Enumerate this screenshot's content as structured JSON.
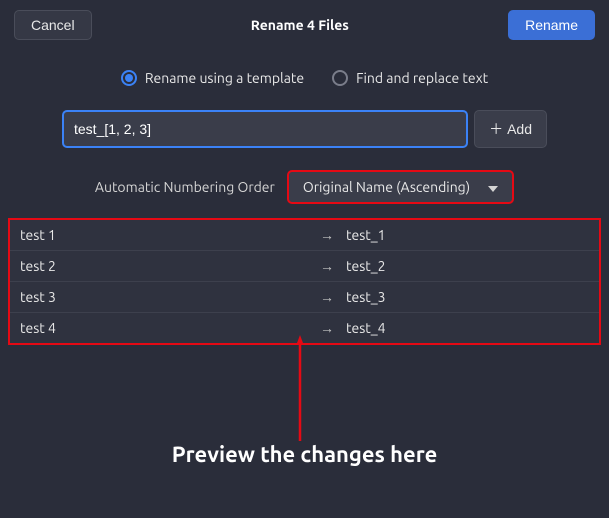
{
  "header": {
    "cancel": "Cancel",
    "title": "Rename 4 Files",
    "rename": "Rename"
  },
  "mode": {
    "template": "Rename using a template",
    "find_replace": "Find and replace text"
  },
  "template": {
    "value": "test_[1, 2, 3]",
    "add": "Add"
  },
  "order": {
    "label": "Automatic Numbering Order",
    "selected": "Original Name (Ascending)"
  },
  "preview": [
    {
      "old": "test 1",
      "new": "test_1"
    },
    {
      "old": "test 2",
      "new": "test_2"
    },
    {
      "old": "test 3",
      "new": "test_3"
    },
    {
      "old": "test 4",
      "new": "test_4"
    }
  ],
  "annotation": "Preview the changes here",
  "arrow_symbol": "→"
}
